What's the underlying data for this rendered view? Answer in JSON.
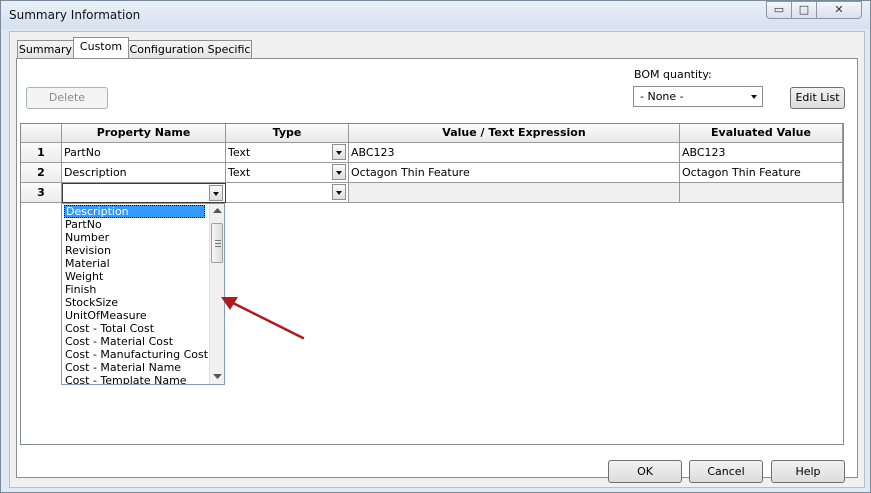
{
  "window": {
    "title": "Summary Information",
    "min_glyph": "▭",
    "max_glyph": "□",
    "close_glyph": "✕"
  },
  "tabs": [
    {
      "label": "Summary"
    },
    {
      "label": "Custom"
    },
    {
      "label": "Configuration Specific"
    }
  ],
  "toolbar": {
    "delete_label": "Delete",
    "bom_label": "BOM quantity:",
    "bom_value": "- None -",
    "edit_list_label": "Edit List"
  },
  "grid": {
    "headers": [
      "Property Name",
      "Type",
      "Value / Text Expression",
      "Evaluated Value"
    ],
    "rows": [
      {
        "num": "1",
        "name": "PartNo",
        "type": "Text",
        "value": "ABC123",
        "evaluated": "ABC123"
      },
      {
        "num": "2",
        "name": "Description",
        "type": "Text",
        "value": "Octagon Thin Feature",
        "evaluated": "Octagon Thin Feature"
      },
      {
        "num": "3",
        "name": "",
        "type": "",
        "value": "",
        "evaluated": ""
      }
    ]
  },
  "dropdown": {
    "items": [
      "Description",
      "PartNo",
      "Number",
      "Revision",
      "Material",
      "Weight",
      "Finish",
      "StockSize",
      "UnitOfMeasure",
      "Cost - Total Cost",
      "Cost - Material Cost",
      "Cost - Manufacturing Cost",
      "Cost - Material Name",
      "Cost - Template Name"
    ],
    "selected_index": 0
  },
  "footer": {
    "ok_label": "OK",
    "cancel_label": "Cancel",
    "help_label": "Help"
  },
  "colors": {
    "arrow": "#b0191e",
    "selection": "#3399ff"
  }
}
